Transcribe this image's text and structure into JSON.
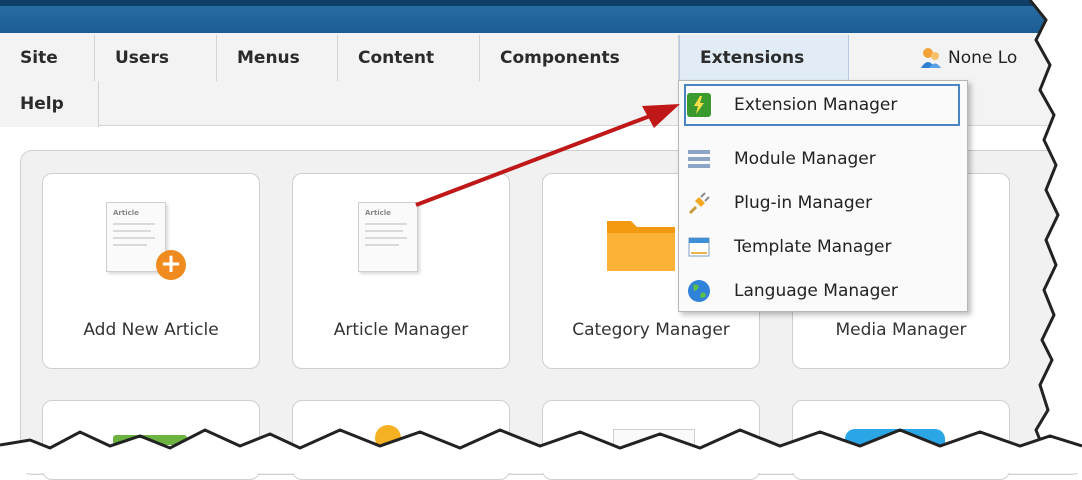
{
  "menu": {
    "row1": [
      {
        "label": "Site",
        "name": "menu-site",
        "w": 95
      },
      {
        "label": "Users",
        "name": "menu-users",
        "w": 122
      },
      {
        "label": "Menus",
        "name": "menu-menus",
        "w": 121
      },
      {
        "label": "Content",
        "name": "menu-content",
        "w": 142
      },
      {
        "label": "Components",
        "name": "menu-components",
        "w": 199
      },
      {
        "label": "Extensions",
        "name": "menu-extensions",
        "w": 170
      }
    ],
    "row2": [
      {
        "label": "Help",
        "name": "menu-help",
        "w": 99
      }
    ],
    "user_text": "None Lo"
  },
  "dropdown": {
    "items": [
      {
        "label": "Extension Manager",
        "icon": "extension-manager-icon"
      },
      {
        "label": "Module Manager",
        "icon": "module-manager-icon"
      },
      {
        "label": "Plug-in Manager",
        "icon": "plugin-manager-icon"
      },
      {
        "label": "Template Manager",
        "icon": "template-manager-icon"
      },
      {
        "label": "Language Manager",
        "icon": "language-manager-icon"
      }
    ]
  },
  "cards": [
    {
      "label": "Add New Article"
    },
    {
      "label": "Article Manager"
    },
    {
      "label": "Category Manager"
    },
    {
      "label": "Media Manager"
    }
  ],
  "doc_text": "Article",
  "colors": {
    "topbar": "#1b5d94",
    "highlight": "#e8f23a",
    "arrow": "#c01818",
    "folder": "#f8a21f",
    "plus": "#f08c1f"
  }
}
